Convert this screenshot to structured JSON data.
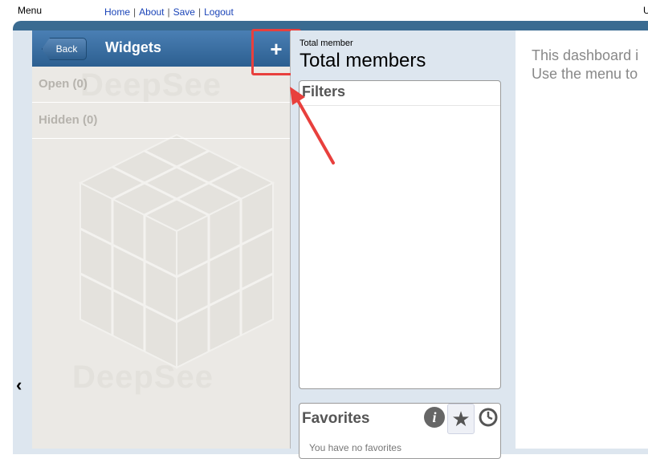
{
  "topbar": {
    "menu_label": "Menu",
    "links": [
      "Home",
      "About",
      "Save",
      "Logout"
    ],
    "corner_text": "U"
  },
  "widgets_panel": {
    "back_label": "Back",
    "title": "Widgets",
    "add_label": "+",
    "rows": [
      "Open (0)",
      "Hidden (0)"
    ],
    "watermark": "DeepSee"
  },
  "center": {
    "small_title": "Total member",
    "big_title": "Total members",
    "filters_title": "Filters",
    "favorites_title": "Favorites",
    "favorites_text": "You have no favorites"
  },
  "right": {
    "line1": "This dashboard i",
    "line2": "Use the menu to"
  },
  "colors": {
    "header_blue": "#2c5f90",
    "frame_blue": "#3a6b91",
    "highlight_red": "#e8403d"
  },
  "icons": {
    "collapse": "chevron-left-icon",
    "info": "info-icon",
    "star": "star-icon",
    "clock": "clock-icon"
  }
}
